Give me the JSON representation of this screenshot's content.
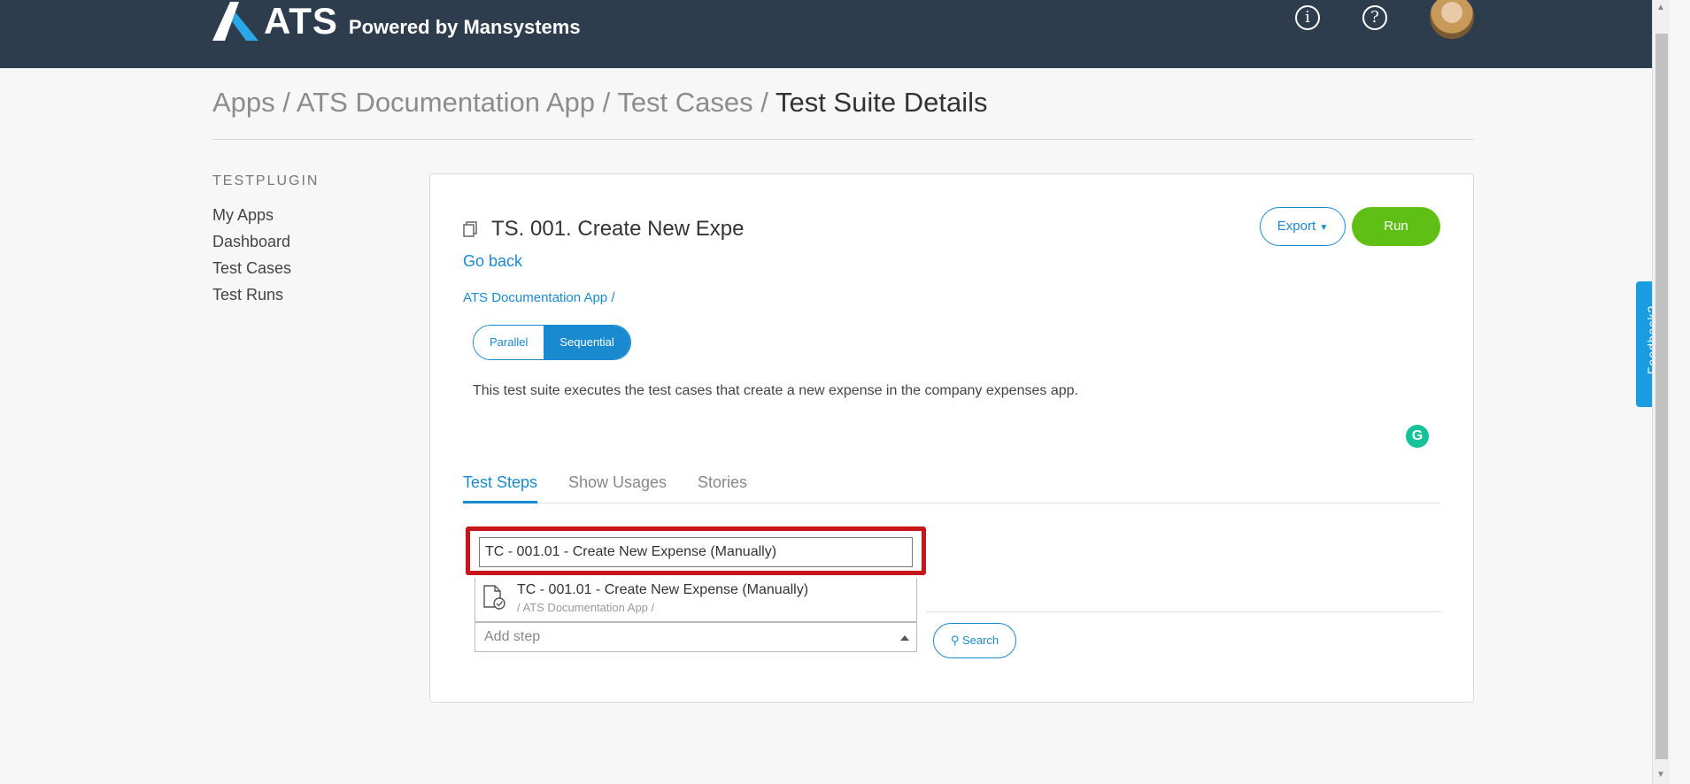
{
  "header": {
    "logo_text": "ATS",
    "tagline": "Powered by Mansystems",
    "info_icon": "info-icon",
    "help_icon": "help-icon"
  },
  "breadcrumb": {
    "items": [
      "Apps",
      "ATS Documentation App",
      "Test Cases"
    ],
    "separator": "/",
    "current": "Test Suite Details"
  },
  "sidebar": {
    "title": "TESTPLUGIN",
    "items": [
      {
        "label": "My Apps"
      },
      {
        "label": "Dashboard"
      },
      {
        "label": "Test Cases"
      },
      {
        "label": "Test Runs"
      }
    ]
  },
  "suite": {
    "title": "TS. 001. Create New Expe",
    "go_back": "Go back",
    "app_link": "ATS Documentation App /",
    "mode_options": [
      "Parallel",
      "Sequential"
    ],
    "selected_mode": "Sequential",
    "description": "This test suite executes the test cases that create a new expense in the company expenses app.",
    "export_label": "Export",
    "run_label": "Run"
  },
  "tabs": [
    {
      "label": "Test Steps",
      "active": true
    },
    {
      "label": "Show Usages",
      "active": false
    },
    {
      "label": "Stories",
      "active": false
    }
  ],
  "steps": {
    "search_value": "TC - 001.01 - Create New Expense (Manually)",
    "suggestion_title": "TC - 001.01 - Create New Expense (Manually)",
    "suggestion_path": "/ ATS Documentation App /",
    "add_step_placeholder": "Add step",
    "search_button": "Search"
  },
  "feedback_label": "Feedback?",
  "colors": {
    "header_bg": "#2e3d4d",
    "accent": "#1a8ad0",
    "run_green": "#5fbf15",
    "highlight_red": "#c8151b"
  }
}
